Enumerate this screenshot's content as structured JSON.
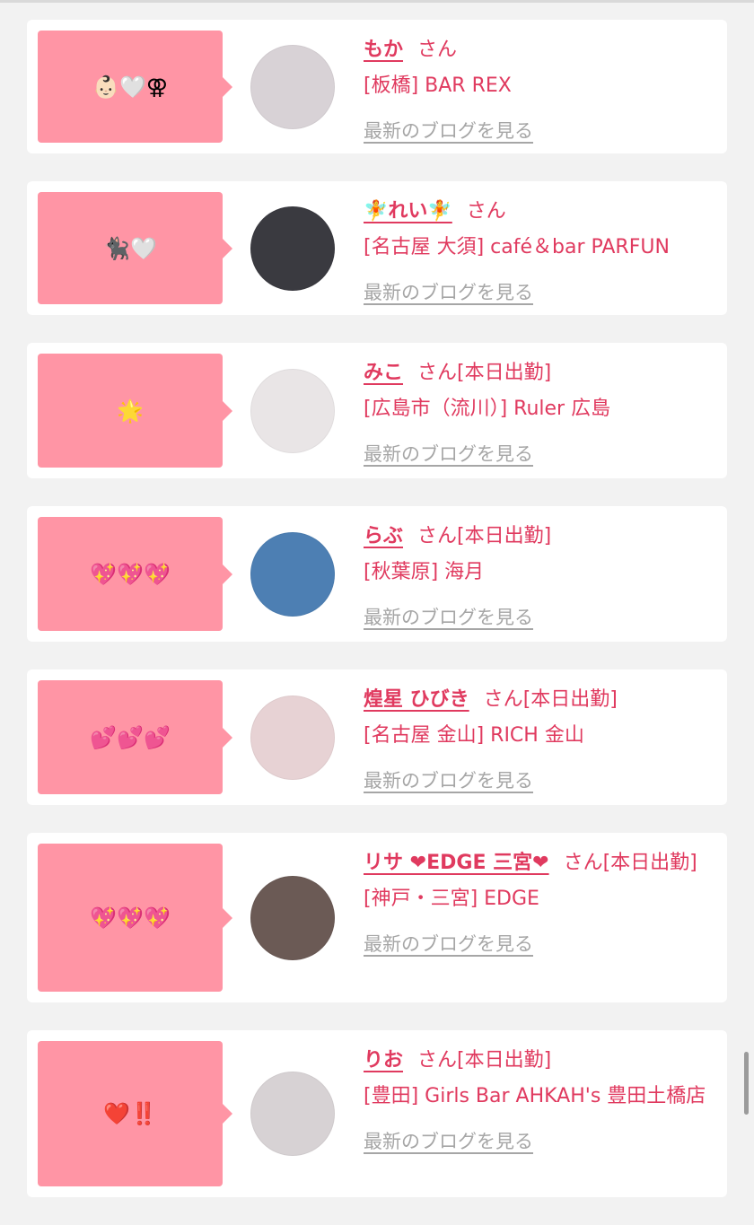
{
  "cards": [
    {
      "emoji": "👶🏻🤍⚢",
      "name": "もか",
      "san": "さん",
      "status": "",
      "shop": "[板橋] BAR REX",
      "blog": "最新のブログを見る",
      "avatar_color": "#d8d2d6"
    },
    {
      "emoji": "🐈‍⬛🤍",
      "name": "🧚れい🧚",
      "san": "さん",
      "status": "",
      "shop": "[名古屋 大須] café＆bar PARFUN",
      "blog": "最新のブログを見る",
      "avatar_color": "#3a3a40"
    },
    {
      "emoji": "🌟",
      "name": "みこ",
      "san": "さん",
      "status": "[本日出勤]",
      "shop": "[広島市（流川）] Ruler 広島",
      "blog": "最新のブログを見る",
      "avatar_color": "#e9e5e6"
    },
    {
      "emoji": "💖💖💖",
      "name": "らぶ",
      "san": "さん",
      "status": "[本日出勤]",
      "shop": "[秋葉原] 海月",
      "blog": "最新のブログを見る",
      "avatar_color": "#4d7fb3"
    },
    {
      "emoji": "💕💕💕",
      "name": "煌星 ひびき",
      "san": "さん",
      "status": "[本日出勤]",
      "shop": "[名古屋 金山] RICH 金山",
      "blog": "最新のブログを見る",
      "avatar_color": "#e7d2d4"
    },
    {
      "emoji": "💖💖💖",
      "name": "リサ ❤EDGE 三宮❤",
      "san": "さん",
      "status": "[本日出勤]",
      "shop": "[神戸・三宮] EDGE",
      "blog": "最新のブログを見る",
      "avatar_color": "#6b5a55"
    },
    {
      "emoji": "❤️‼️",
      "name": "りお",
      "san": "さん",
      "status": "[本日出勤]",
      "shop": "[豊田] Girls Bar AHKAH's 豊田土橋店",
      "blog": "最新のブログを見る",
      "avatar_color": "#d7d2d4"
    }
  ],
  "layout_heights": [
    149,
    149,
    151,
    151,
    151,
    189,
    186
  ]
}
